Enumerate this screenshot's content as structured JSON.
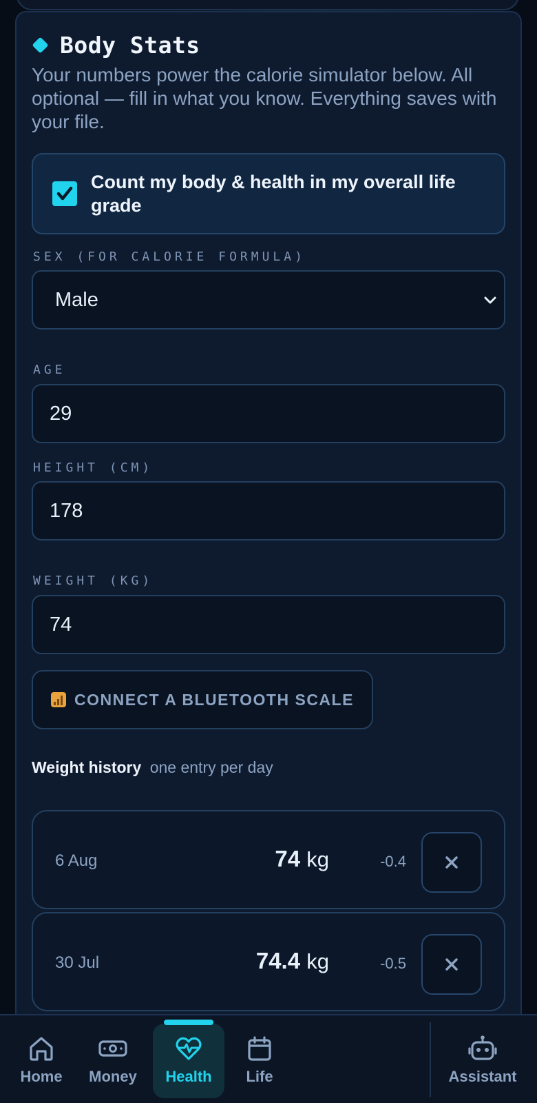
{
  "section": {
    "title": "Body Stats",
    "description": "Your numbers power the calorie simulator below. All optional — fill in what you know. Everything saves with your file."
  },
  "toggle": {
    "label": "Count my body & health in my overall life grade",
    "checked": true
  },
  "fields": {
    "sex": {
      "label": "SEX (FOR CALORIE FORMULA)",
      "value": "Male"
    },
    "age": {
      "label": "AGE",
      "value": "29"
    },
    "height": {
      "label": "HEIGHT (CM)",
      "value": "178"
    },
    "weight": {
      "label": "WEIGHT (KG)",
      "value": "74"
    }
  },
  "connect_button": {
    "icon": "bluetooth-signal-icon",
    "label": "CONNECT A BLUETOOTH SCALE"
  },
  "history": {
    "title": "Weight history",
    "subtitle": "one entry per day",
    "entries": [
      {
        "date": "6 Aug",
        "weight": "74",
        "unit": "kg",
        "delta": "-0.4"
      },
      {
        "date": "30 Jul",
        "weight": "74.4",
        "unit": "kg",
        "delta": "-0.5"
      }
    ]
  },
  "nav": {
    "items": [
      {
        "label": "Home",
        "icon": "home-icon"
      },
      {
        "label": "Money",
        "icon": "money-icon"
      },
      {
        "label": "Health",
        "icon": "heart-pulse-icon",
        "active": true
      },
      {
        "label": "Life",
        "icon": "calendar-icon"
      },
      {
        "label": "Assistant",
        "icon": "robot-icon"
      }
    ]
  },
  "colors": {
    "accent": "#22d3ee",
    "background": "#070d16",
    "card": "#0e1a2e",
    "muted_text": "#8ca3c2"
  }
}
